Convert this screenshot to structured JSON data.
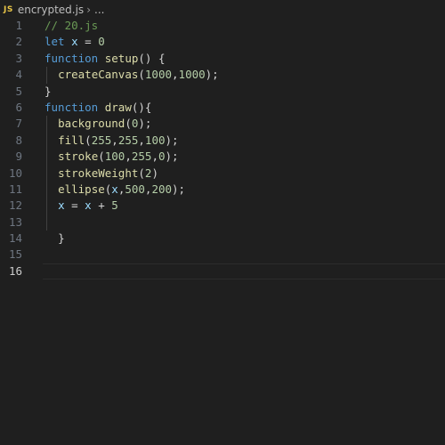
{
  "breadcrumb": {
    "badge": "JS",
    "filename": "encrypted.js",
    "separator": "›",
    "more": "..."
  },
  "editor": {
    "current_line": 16,
    "lines": [
      {
        "number": "1",
        "tokens": [
          {
            "t": "// 20.js",
            "c": "comment"
          }
        ]
      },
      {
        "number": "2",
        "tokens": [
          {
            "t": "let",
            "c": "kw"
          },
          {
            "t": " ",
            "c": "op"
          },
          {
            "t": "x",
            "c": "var"
          },
          {
            "t": " = ",
            "c": "op"
          },
          {
            "t": "0",
            "c": "num"
          }
        ]
      },
      {
        "number": "3",
        "tokens": [
          {
            "t": "function",
            "c": "kw"
          },
          {
            "t": " ",
            "c": "op"
          },
          {
            "t": "setup",
            "c": "fn"
          },
          {
            "t": "() {",
            "c": "punct"
          }
        ]
      },
      {
        "number": "4",
        "indent": true,
        "tokens": [
          {
            "t": "  ",
            "c": "op"
          },
          {
            "t": "createCanvas",
            "c": "fn"
          },
          {
            "t": "(",
            "c": "punct"
          },
          {
            "t": "1000",
            "c": "num"
          },
          {
            "t": ",",
            "c": "punct"
          },
          {
            "t": "1000",
            "c": "num"
          },
          {
            "t": ");",
            "c": "punct"
          }
        ]
      },
      {
        "number": "5",
        "tokens": [
          {
            "t": "}",
            "c": "punct"
          }
        ]
      },
      {
        "number": "6",
        "tokens": [
          {
            "t": "function",
            "c": "kw"
          },
          {
            "t": " ",
            "c": "op"
          },
          {
            "t": "draw",
            "c": "fn"
          },
          {
            "t": "(){",
            "c": "punct"
          }
        ]
      },
      {
        "number": "7",
        "indent": true,
        "tokens": [
          {
            "t": "  ",
            "c": "op"
          },
          {
            "t": "background",
            "c": "fn"
          },
          {
            "t": "(",
            "c": "punct"
          },
          {
            "t": "0",
            "c": "num"
          },
          {
            "t": ");",
            "c": "punct"
          }
        ]
      },
      {
        "number": "8",
        "indent": true,
        "tokens": [
          {
            "t": "  ",
            "c": "op"
          },
          {
            "t": "fill",
            "c": "fn"
          },
          {
            "t": "(",
            "c": "punct"
          },
          {
            "t": "255",
            "c": "num"
          },
          {
            "t": ",",
            "c": "punct"
          },
          {
            "t": "255",
            "c": "num"
          },
          {
            "t": ",",
            "c": "punct"
          },
          {
            "t": "100",
            "c": "num"
          },
          {
            "t": ");",
            "c": "punct"
          }
        ]
      },
      {
        "number": "9",
        "indent": true,
        "tokens": [
          {
            "t": "  ",
            "c": "op"
          },
          {
            "t": "stroke",
            "c": "fn"
          },
          {
            "t": "(",
            "c": "punct"
          },
          {
            "t": "100",
            "c": "num"
          },
          {
            "t": ",",
            "c": "punct"
          },
          {
            "t": "255",
            "c": "num"
          },
          {
            "t": ",",
            "c": "punct"
          },
          {
            "t": "0",
            "c": "num"
          },
          {
            "t": ");",
            "c": "punct"
          }
        ]
      },
      {
        "number": "10",
        "indent": true,
        "tokens": [
          {
            "t": "  ",
            "c": "op"
          },
          {
            "t": "strokeWeight",
            "c": "fn"
          },
          {
            "t": "(",
            "c": "punct"
          },
          {
            "t": "2",
            "c": "num"
          },
          {
            "t": ")",
            "c": "punct"
          }
        ]
      },
      {
        "number": "11",
        "indent": true,
        "tokens": [
          {
            "t": "  ",
            "c": "op"
          },
          {
            "t": "ellipse",
            "c": "fn"
          },
          {
            "t": "(",
            "c": "punct"
          },
          {
            "t": "x",
            "c": "var"
          },
          {
            "t": ",",
            "c": "punct"
          },
          {
            "t": "500",
            "c": "num"
          },
          {
            "t": ",",
            "c": "punct"
          },
          {
            "t": "200",
            "c": "num"
          },
          {
            "t": ");",
            "c": "punct"
          }
        ]
      },
      {
        "number": "12",
        "indent": true,
        "tokens": [
          {
            "t": "  ",
            "c": "op"
          },
          {
            "t": "x",
            "c": "var"
          },
          {
            "t": " = ",
            "c": "op"
          },
          {
            "t": "x",
            "c": "var"
          },
          {
            "t": " + ",
            "c": "op"
          },
          {
            "t": "5",
            "c": "num"
          }
        ]
      },
      {
        "number": "13",
        "indent": true,
        "tokens": []
      },
      {
        "number": "14",
        "indent": false,
        "tokens": [
          {
            "t": "  ",
            "c": "op"
          },
          {
            "t": "}",
            "c": "punct"
          }
        ]
      },
      {
        "number": "15",
        "tokens": []
      },
      {
        "number": "16",
        "tokens": []
      }
    ]
  }
}
